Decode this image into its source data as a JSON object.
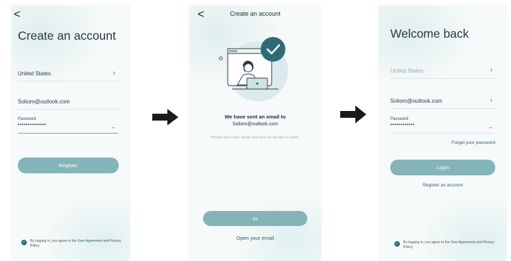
{
  "screen1": {
    "back": "<",
    "title": "Create an account",
    "country": "United States",
    "email": "Soliom@outlook.com",
    "password_label": "Password",
    "password_dots": "••••••••••••••",
    "register": "Register",
    "agree_prefix": "By logging in, you agree to the",
    "agree_link1": "User Agreement",
    "agree_mid": "and",
    "agree_link2": "Privacy Policy."
  },
  "screen2": {
    "back": "<",
    "title": "Create an account",
    "sent": "We have sent an email to",
    "email": "Soliom@outlook.com",
    "hint": "Please open your Email and click on the link to verify.",
    "countdown": "4s",
    "open_email": "Open your email"
  },
  "screen3": {
    "title": "Welcome back",
    "country": "United States",
    "email": "Soliom@outlook.com",
    "password_label": "Password",
    "password_dots": "••••••••••••",
    "forgot": "Forget your password",
    "login": "Login",
    "register_link": "Register an account",
    "agree_prefix": "By logging in, you agree to the",
    "agree_link1": "User Agreement",
    "agree_mid": "and",
    "agree_link2": "Privacy Policy."
  },
  "colors": {
    "button": "#84b4b7",
    "accent": "#2f6b74",
    "link": "#2f5d66",
    "background": "#f6fafa"
  },
  "icons": [
    "back-arrow-icon",
    "chevron-right-icon",
    "eye-closed-icon",
    "check-icon",
    "flow-arrow-icon",
    "email-sent-illustration"
  ]
}
